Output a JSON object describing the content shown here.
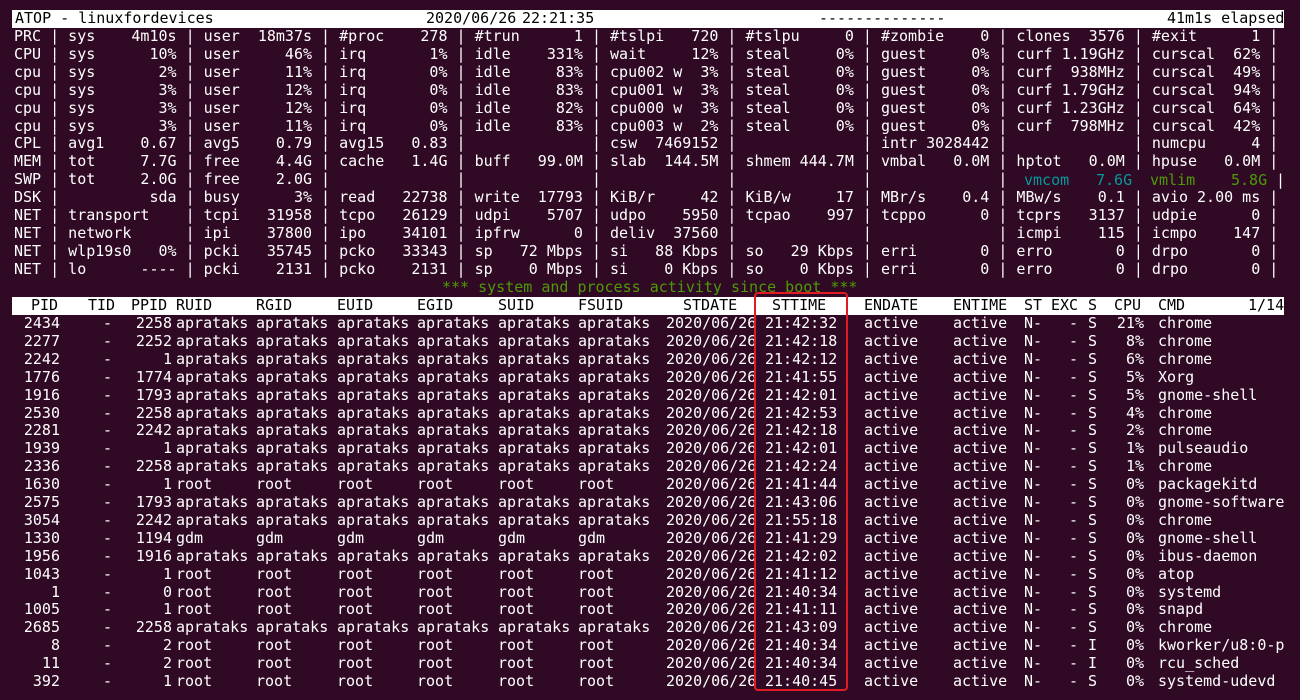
{
  "window": {
    "header_left": "ATOP - linuxfordevices",
    "header_date": "2020/06/26",
    "header_time": "22:21:35",
    "header_dashes": "--------------",
    "header_elapsed": "41m1s elapsed"
  },
  "sys_lines": [
    "PRC | sys    4m10s | user  18m37s | #proc    278 | #trun      1 | #tslpi   720 | #tslpu     0 | #zombie    0 | clones  3576 | #exit      1 |",
    "CPU | sys      10% | user     46% | irq       1% | idle    331% | wait     12% | steal     0% | guest     0% | curf 1.19GHz | curscal  62% |",
    "cpu | sys       2% | user     11% | irq       0% | idle     83% | cpu002 w  3% | steal     0% | guest     0% | curf  938MHz | curscal  49% |",
    "cpu | sys       3% | user     12% | irq       0% | idle     83% | cpu001 w  3% | steal     0% | guest     0% | curf 1.79GHz | curscal  94% |",
    "cpu | sys       3% | user     12% | irq       0% | idle     82% | cpu000 w  3% | steal     0% | guest     0% | curf 1.23GHz | curscal  64% |",
    "cpu | sys       3% | user     11% | irq       0% | idle     83% | cpu003 w  2% | steal     0% | guest     0% | curf  798MHz | curscal  42% |",
    "CPL | avg1    0.67 | avg5    0.79 | avg15   0.83 |              | csw  7469152 |              | intr 3028442 |              | numcpu     4 |",
    "MEM | tot     7.7G | free    4.4G | cache   1.4G | buff   99.0M | slab  144.5M | shmem 444.7M | vmbal   0.0M | hptot   0.0M | hpuse   0.0M |",
    "SWP | tot     2.0G | free    2.0G |              |              |              |              |              |",
    "DSK |          sda | busy      3% | read   22738 | write  17793 | KiB/r     42 | KiB/w     17 | MBr/s    0.4 | MBw/s    0.1 | avio 2.00 ms |",
    "NET | transport    | tcpi   31958 | tcpo   26129 | udpi    5707 | udpo    5950 | tcpao    997 | tcppo      0 | tcprs   3137 | udpie      0 |",
    "NET | network      | ipi    37800 | ipo    34101 | ipfrw      0 | deliv  37560 |              |              | icmpi    115 | icmpo    147 |",
    "NET | wlp19s0   0% | pcki   35745 | pcko   33343 | sp   72 Mbps | si   88 Kbps | so   29 Kbps | erri       0 | erro       0 | drpo       0 |",
    "NET | lo      ---- | pcki    2131 | pcko    2131 | sp    0 Mbps | si    0 Kbps | so    0 Kbps | erri       0 | erro       0 | drpo       0 |"
  ],
  "swp_green": {
    "vmcom_label": "vmcom",
    "vmcom_value": "7.6G",
    "vmlim_label": "vmlim",
    "vmlim_value": "5.8G",
    "sep": "|"
  },
  "banner": "*** system and process activity since boot ***",
  "colors": {
    "background": "#300a24",
    "foreground": "#ffffff",
    "banner_green": "#4e9a06",
    "swp_cyan": "#06989a",
    "swp_green": "#4e9a06",
    "highlight_box": "#e01b24"
  },
  "process_table": {
    "columns": [
      "PID",
      "TID",
      "PPID",
      "RUID",
      "RGID",
      "EUID",
      "EGID",
      "SUID",
      "FSUID",
      "STDATE",
      "STTIME",
      "ENDATE",
      "ENTIME",
      "ST",
      "EXC",
      "S",
      "CPU",
      "CMD",
      "1/14"
    ],
    "rows": [
      [
        "2434",
        "-",
        "2258",
        "aprataks",
        "aprataks",
        "aprataks",
        "aprataks",
        "aprataks",
        "aprataks",
        "2020/06/26",
        "21:42:32",
        "active",
        "active",
        "N-",
        "-",
        "S",
        "21%",
        "chrome"
      ],
      [
        "2277",
        "-",
        "2252",
        "aprataks",
        "aprataks",
        "aprataks",
        "aprataks",
        "aprataks",
        "aprataks",
        "2020/06/26",
        "21:42:18",
        "active",
        "active",
        "N-",
        "-",
        "S",
        "8%",
        "chrome"
      ],
      [
        "2242",
        "-",
        "1",
        "aprataks",
        "aprataks",
        "aprataks",
        "aprataks",
        "aprataks",
        "aprataks",
        "2020/06/26",
        "21:42:12",
        "active",
        "active",
        "N-",
        "-",
        "S",
        "6%",
        "chrome"
      ],
      [
        "1776",
        "-",
        "1774",
        "aprataks",
        "aprataks",
        "aprataks",
        "aprataks",
        "aprataks",
        "aprataks",
        "2020/06/26",
        "21:41:55",
        "active",
        "active",
        "N-",
        "-",
        "S",
        "5%",
        "Xorg"
      ],
      [
        "1916",
        "-",
        "1793",
        "aprataks",
        "aprataks",
        "aprataks",
        "aprataks",
        "aprataks",
        "aprataks",
        "2020/06/26",
        "21:42:01",
        "active",
        "active",
        "N-",
        "-",
        "S",
        "5%",
        "gnome-shell"
      ],
      [
        "2530",
        "-",
        "2258",
        "aprataks",
        "aprataks",
        "aprataks",
        "aprataks",
        "aprataks",
        "aprataks",
        "2020/06/26",
        "21:42:53",
        "active",
        "active",
        "N-",
        "-",
        "S",
        "4%",
        "chrome"
      ],
      [
        "2281",
        "-",
        "2242",
        "aprataks",
        "aprataks",
        "aprataks",
        "aprataks",
        "aprataks",
        "aprataks",
        "2020/06/26",
        "21:42:18",
        "active",
        "active",
        "N-",
        "-",
        "S",
        "2%",
        "chrome"
      ],
      [
        "1939",
        "-",
        "1",
        "aprataks",
        "aprataks",
        "aprataks",
        "aprataks",
        "aprataks",
        "aprataks",
        "2020/06/26",
        "21:42:01",
        "active",
        "active",
        "N-",
        "-",
        "S",
        "1%",
        "pulseaudio"
      ],
      [
        "2336",
        "-",
        "2258",
        "aprataks",
        "aprataks",
        "aprataks",
        "aprataks",
        "aprataks",
        "aprataks",
        "2020/06/26",
        "21:42:24",
        "active",
        "active",
        "N-",
        "-",
        "S",
        "1%",
        "chrome"
      ],
      [
        "1630",
        "-",
        "1",
        "root",
        "root",
        "root",
        "root",
        "root",
        "root",
        "2020/06/26",
        "21:41:44",
        "active",
        "active",
        "N-",
        "-",
        "S",
        "0%",
        "packagekitd"
      ],
      [
        "2575",
        "-",
        "1793",
        "aprataks",
        "aprataks",
        "aprataks",
        "aprataks",
        "aprataks",
        "aprataks",
        "2020/06/26",
        "21:43:06",
        "active",
        "active",
        "N-",
        "-",
        "S",
        "0%",
        "gnome-software"
      ],
      [
        "3054",
        "-",
        "2242",
        "aprataks",
        "aprataks",
        "aprataks",
        "aprataks",
        "aprataks",
        "aprataks",
        "2020/06/26",
        "21:55:18",
        "active",
        "active",
        "N-",
        "-",
        "S",
        "0%",
        "chrome"
      ],
      [
        "1330",
        "-",
        "1194",
        "gdm",
        "gdm",
        "gdm",
        "gdm",
        "gdm",
        "gdm",
        "2020/06/26",
        "21:41:29",
        "active",
        "active",
        "N-",
        "-",
        "S",
        "0%",
        "gnome-shell"
      ],
      [
        "1956",
        "-",
        "1916",
        "aprataks",
        "aprataks",
        "aprataks",
        "aprataks",
        "aprataks",
        "aprataks",
        "2020/06/26",
        "21:42:02",
        "active",
        "active",
        "N-",
        "-",
        "S",
        "0%",
        "ibus-daemon"
      ],
      [
        "1043",
        "-",
        "1",
        "root",
        "root",
        "root",
        "root",
        "root",
        "root",
        "2020/06/26",
        "21:41:12",
        "active",
        "active",
        "N-",
        "-",
        "S",
        "0%",
        "atop"
      ],
      [
        "1",
        "-",
        "0",
        "root",
        "root",
        "root",
        "root",
        "root",
        "root",
        "2020/06/26",
        "21:40:34",
        "active",
        "active",
        "N-",
        "-",
        "S",
        "0%",
        "systemd"
      ],
      [
        "1005",
        "-",
        "1",
        "root",
        "root",
        "root",
        "root",
        "root",
        "root",
        "2020/06/26",
        "21:41:11",
        "active",
        "active",
        "N-",
        "-",
        "S",
        "0%",
        "snapd"
      ],
      [
        "2685",
        "-",
        "2258",
        "aprataks",
        "aprataks",
        "aprataks",
        "aprataks",
        "aprataks",
        "aprataks",
        "2020/06/26",
        "21:43:09",
        "active",
        "active",
        "N-",
        "-",
        "S",
        "0%",
        "chrome"
      ],
      [
        "8",
        "-",
        "2",
        "root",
        "root",
        "root",
        "root",
        "root",
        "root",
        "2020/06/26",
        "21:40:34",
        "active",
        "active",
        "N-",
        "-",
        "I",
        "0%",
        "kworker/u8:0-p"
      ],
      [
        "11",
        "-",
        "2",
        "root",
        "root",
        "root",
        "root",
        "root",
        "root",
        "2020/06/26",
        "21:40:34",
        "active",
        "active",
        "N-",
        "-",
        "I",
        "0%",
        "rcu_sched"
      ],
      [
        "392",
        "-",
        "1",
        "root",
        "root",
        "root",
        "root",
        "root",
        "root",
        "2020/06/26",
        "21:40:45",
        "active",
        "active",
        "N-",
        "-",
        "S",
        "0%",
        "systemd-udevd"
      ]
    ]
  }
}
